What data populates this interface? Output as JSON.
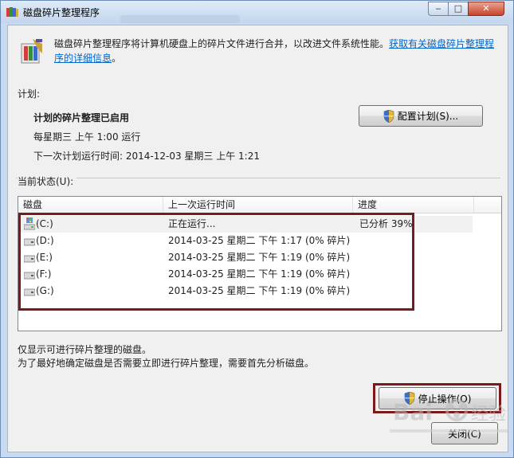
{
  "window": {
    "title": "磁盘碎片整理程序"
  },
  "header": {
    "description": "磁盘碎片整理程序将计算机硬盘上的碎片文件进行合并，以改进文件系统性能。",
    "link_text": "获取有关磁盘碎片整理程序的详细信息",
    "link_end": "。"
  },
  "schedule": {
    "section_label": "计划:",
    "status": "计划的碎片整理已启用",
    "frequency": "每星期三  上午 1:00 运行",
    "next_run": "下一次计划运行时间: 2014-12-03 星期三 上午 1:21",
    "configure_button": "配置计划(S)..."
  },
  "current_status": {
    "section_label": "当前状态(U):",
    "columns": [
      "磁盘",
      "上一次运行时间",
      "进度"
    ],
    "rows": [
      {
        "disk": "(C:)",
        "last_run": "正在运行...",
        "progress": "已分析 39%"
      },
      {
        "disk": "(D:)",
        "last_run": "2014-03-25 星期二 下午 1:17 (0% 碎片)",
        "progress": ""
      },
      {
        "disk": "(E:)",
        "last_run": "2014-03-25 星期二 下午 1:19 (0% 碎片)",
        "progress": ""
      },
      {
        "disk": "(F:)",
        "last_run": "2014-03-25 星期二 下午 1:19 (0% 碎片)",
        "progress": ""
      },
      {
        "disk": "(G:)",
        "last_run": "2014-03-25 星期二 下午 1:19 (0% 碎片)",
        "progress": ""
      }
    ]
  },
  "notes": {
    "line1": "仅显示可进行碎片整理的磁盘。",
    "line2": "为了最好地确定磁盘是否需要立即进行碎片整理，需要首先分析磁盘。"
  },
  "buttons": {
    "stop": "停止操作(O)",
    "close": "关闭(C)"
  },
  "colors": {
    "highlight_border": "#7a1b1b",
    "link": "#0066cc"
  }
}
